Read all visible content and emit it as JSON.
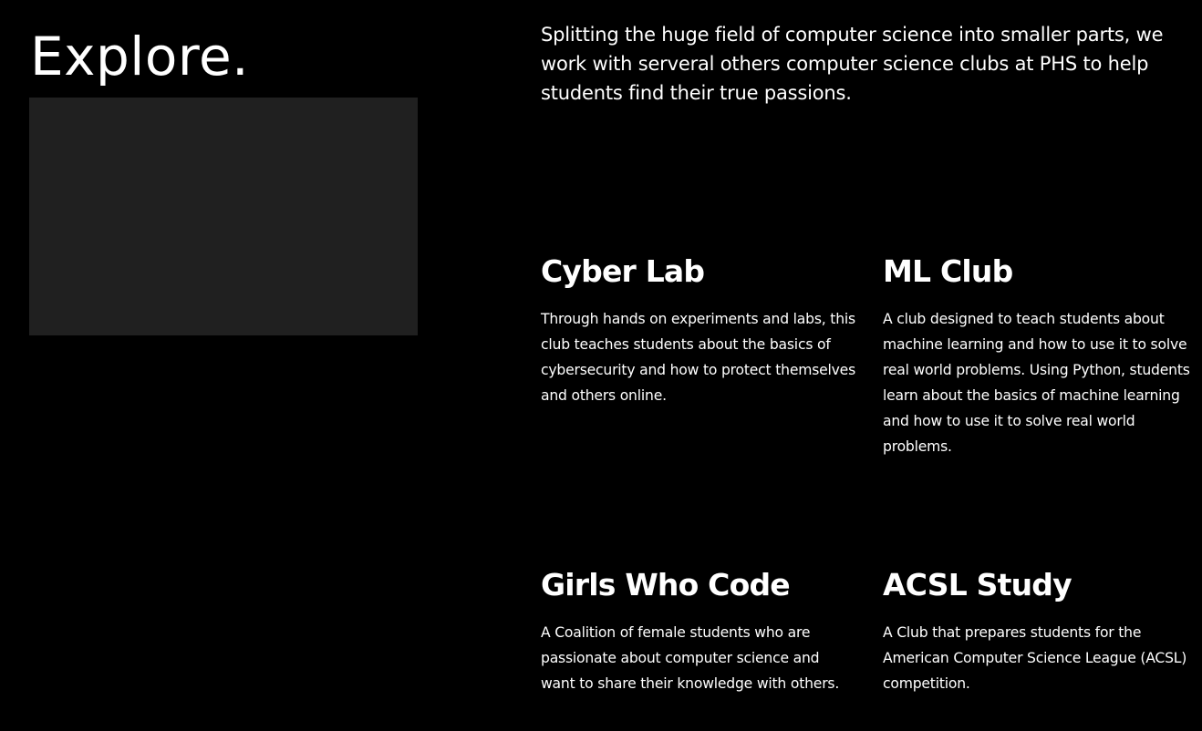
{
  "section": {
    "heading": "Explore.",
    "intro": "Splitting the huge field of computer science into smaller parts, we work with serveral others computer science clubs at PHS to help students find their true passions."
  },
  "clubs": [
    {
      "title": "Cyber Lab",
      "description": "Through hands on experiments and labs, this club teaches students about the basics of cybersecurity and how to protect themselves and others online."
    },
    {
      "title": "ML Club",
      "description": "A club designed to teach students about machine learning and how to use it to solve real world problems. Using Python, students learn about the basics of machine learning and how to use it to solve real world problems."
    },
    {
      "title": "Girls Who Code",
      "description": "A Coalition of female students who are passionate about computer science and want to share their knowledge with others."
    },
    {
      "title": "ACSL Study",
      "description": "A Club that prepares students for the American Computer Science League (ACSL) competition."
    }
  ],
  "colors": {
    "background": "#000000",
    "text": "#ffffff",
    "placeholder": "#202020"
  }
}
